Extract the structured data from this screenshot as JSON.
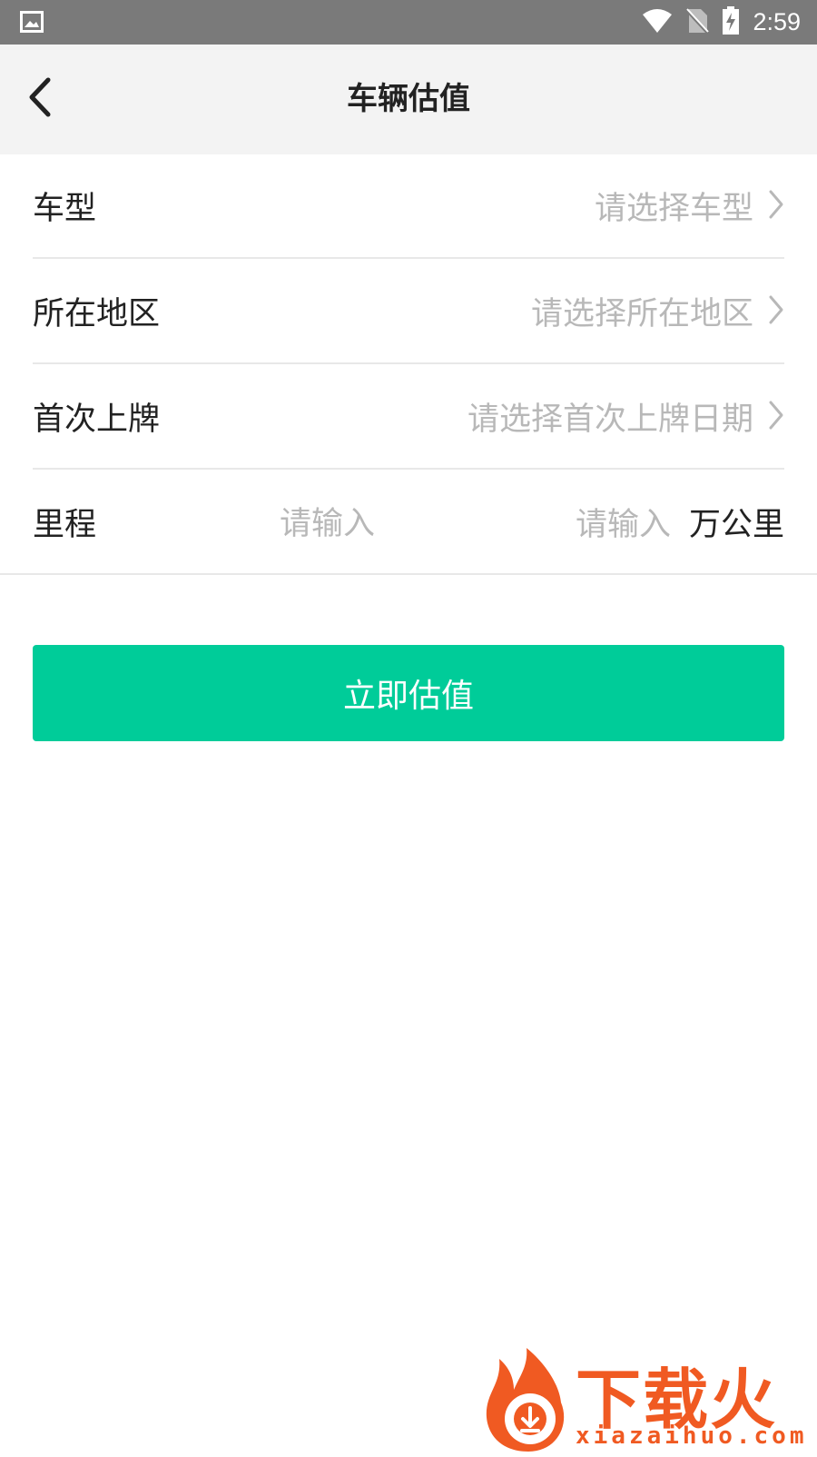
{
  "status_bar": {
    "time": "2:59",
    "icons": [
      "image-icon",
      "wifi-icon",
      "no-sim-icon",
      "battery-charging-icon"
    ]
  },
  "header": {
    "back_icon": "chevron-left-icon",
    "title": "车辆估值"
  },
  "form": {
    "car_model": {
      "label": "车型",
      "placeholder": "请选择车型"
    },
    "region": {
      "label": "所在地区",
      "placeholder": "请选择所在地区"
    },
    "first_registration": {
      "label": "首次上牌",
      "placeholder": "请选择首次上牌日期"
    },
    "mileage": {
      "label": "里程",
      "input_placeholder": "请输入",
      "value_placeholder": "请输入",
      "unit": "万公里"
    }
  },
  "actions": {
    "submit_label": "立即估值"
  },
  "watermark": {
    "logo_text_cn": "下载火",
    "logo_text_en": "xiazaihuo.com"
  },
  "colors": {
    "accent": "#00cc99",
    "watermark": "#f05a22",
    "placeholder": "#b8b8b8",
    "status_bar": "#7a7a7a"
  }
}
